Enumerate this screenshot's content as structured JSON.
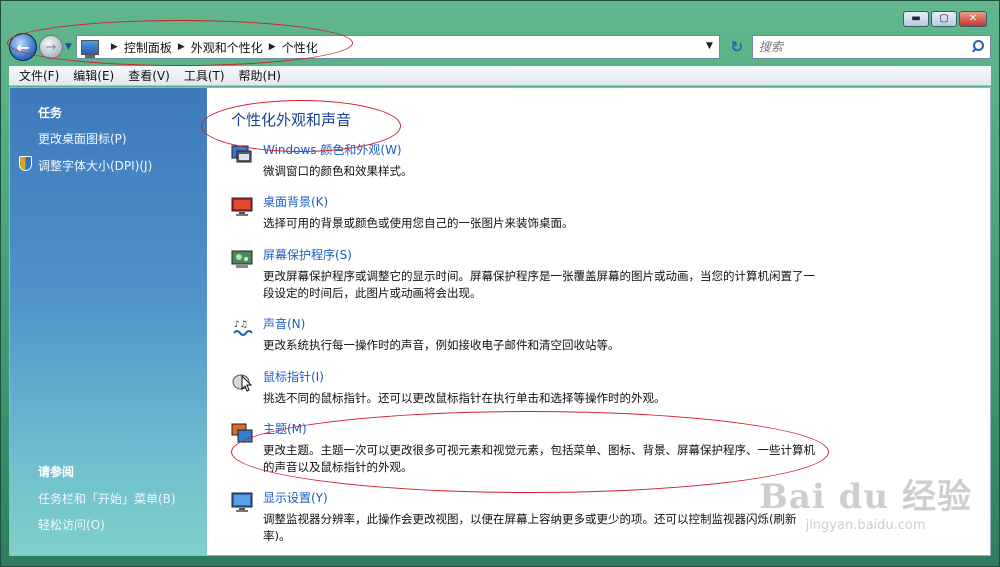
{
  "window": {
    "minimize_glyph": "▬",
    "maximize_glyph": "▢",
    "close_glyph": "✕"
  },
  "nav": {
    "back_glyph": "←",
    "forward_glyph": "→",
    "history_glyph": "▼",
    "refresh_glyph": "↻",
    "address_dropdown_glyph": "▼",
    "breadcrumb": [
      "控制面板",
      "外观和个性化",
      "个性化"
    ],
    "separator_glyph": "▶",
    "search_placeholder": "搜索"
  },
  "menu": [
    "文件(F)",
    "编辑(E)",
    "查看(V)",
    "工具(T)",
    "帮助(H)"
  ],
  "sidebar": {
    "tasks_heading": "任务",
    "tasks": [
      "更改桌面图标(P)",
      "调整字体大小(DPI)(J)"
    ],
    "see_also_heading": "请参阅",
    "see_also": [
      "任务栏和「开始」菜单(B)",
      "轻松访问(O)"
    ]
  },
  "main": {
    "title": "个性化外观和声音",
    "categories": [
      {
        "link": "Windows 颜色和外观(W)",
        "desc": "微调窗口的颜色和效果样式。",
        "icon": "window-color-icon"
      },
      {
        "link": "桌面背景(K)",
        "desc": "选择可用的背景或颜色或使用您自己的一张图片来装饰桌面。",
        "icon": "desktop-background-icon"
      },
      {
        "link": "屏幕保护程序(S)",
        "desc": "更改屏幕保护程序或调整它的显示时间。屏幕保护程序是一张覆盖屏幕的图片或动画，当您的计算机闲置了一段设定的时间后，此图片或动画将会出现。",
        "icon": "screensaver-icon"
      },
      {
        "link": "声音(N)",
        "desc": "更改系统执行每一操作时的声音，例如接收电子邮件和清空回收站等。",
        "icon": "sound-icon"
      },
      {
        "link": "鼠标指针(I)",
        "desc": "挑选不同的鼠标指针。还可以更改鼠标指针在执行单击和选择等操作时的外观。",
        "icon": "mouse-pointer-icon"
      },
      {
        "link": "主题(M)",
        "desc": "更改主题。主题一次可以更改很多可视元素和视觉元素，包括菜单、图标、背景、屏幕保护程序、一些计算机的声音以及鼠标指针的外观。",
        "icon": "theme-icon"
      },
      {
        "link": "显示设置(Y)",
        "desc": "调整监视器分辨率，此操作会更改视图，以便在屏幕上容纳更多或更少的项。还可以控制监视器闪烁(刷新率)。",
        "icon": "display-settings-icon"
      }
    ]
  },
  "watermark": {
    "brand": "Bai du 经验",
    "url": "jingyan.baidu.com"
  },
  "colors": {
    "link": "#1d5fc4",
    "title": "#1c3f94",
    "annotation": "#d11f2a",
    "sidebar_top": "#3e79bd",
    "sidebar_bottom": "#7fd0c8"
  }
}
